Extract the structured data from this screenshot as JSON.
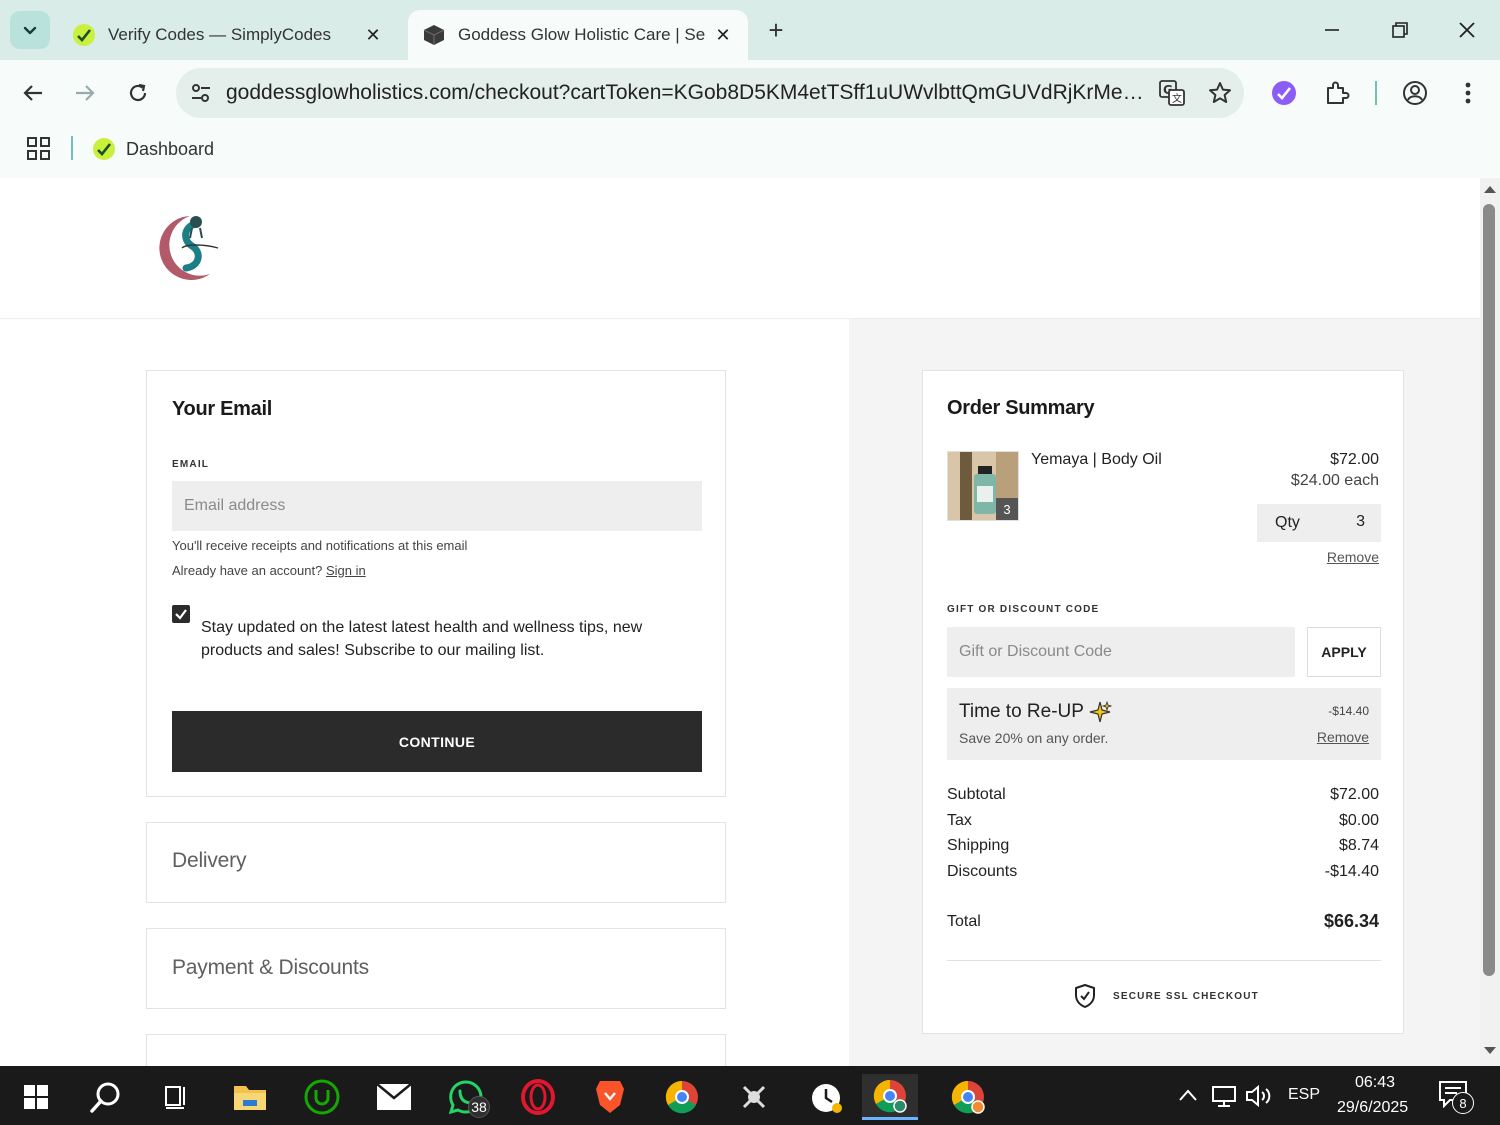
{
  "browser": {
    "tabs": [
      {
        "title": "Verify Codes — SimplyCodes",
        "active": false
      },
      {
        "title": "Goddess Glow Holistic Care | Se",
        "active": true
      }
    ],
    "url": "goddessglowholistics.com/checkout?cartToken=KGob8D5KM4etTSff1uUWvlbttQmGUVdRjKrMeUy...",
    "bookmarks": [
      {
        "label": "Dashboard"
      }
    ]
  },
  "email_section": {
    "title": "Your Email",
    "email_label": "EMAIL",
    "email_placeholder": "Email address",
    "email_value": "",
    "helper_line1": "You'll receive receipts and notifications at this email",
    "helper_line2_prefix": "Already have an account?",
    "sign_in_link": "Sign in",
    "subscribe_checked": true,
    "subscribe_text": "Stay updated on the latest latest health and wellness tips, new products and sales! Subscribe to our mailing list.",
    "continue_label": "CONTINUE"
  },
  "steps": [
    {
      "title": "Delivery"
    },
    {
      "title": "Payment & Discounts"
    }
  ],
  "order_summary": {
    "title": "Order Summary",
    "item": {
      "name": "Yemaya | Body Oil",
      "price": "$72.00",
      "unit_price": "$24.00 each",
      "quantity_badge": "3",
      "qty_label": "Qty",
      "qty_value": "3",
      "remove_label": "Remove"
    },
    "discount_label": "GIFT OR DISCOUNT CODE",
    "discount_placeholder": "Gift or Discount Code",
    "apply_label": "APPLY",
    "promo": {
      "name": "Time to Re-UP",
      "description": "Save 20% on any order.",
      "amount": "-$14.40",
      "remove_label": "Remove"
    },
    "totals": [
      {
        "label": "Subtotal",
        "value": "$72.00"
      },
      {
        "label": "Tax",
        "value": "$0.00"
      },
      {
        "label": "Shipping",
        "value": "$8.74"
      },
      {
        "label": "Discounts",
        "value": "-$14.40"
      }
    ],
    "total_label": "Total",
    "total_value": "$66.34",
    "secure_label": "SECURE SSL CHECKOUT"
  },
  "taskbar": {
    "whatsapp_badge": "38",
    "language": "ESP",
    "time": "06:43",
    "date": "29/6/2025",
    "notification_count": "8"
  }
}
